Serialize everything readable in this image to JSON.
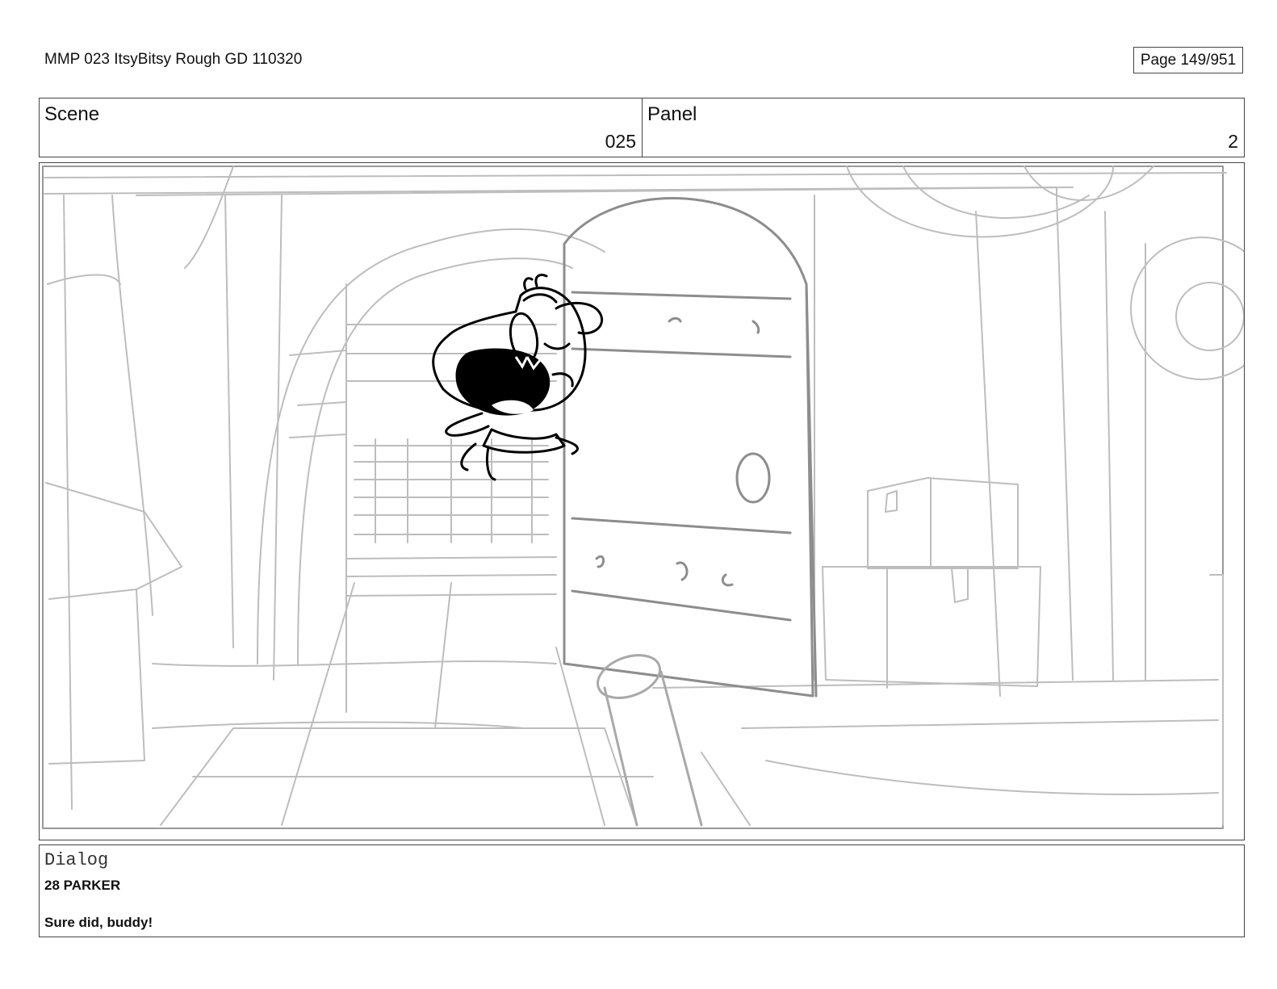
{
  "header": {
    "title": "MMP 023 ItsyBitsy Rough GD 110320",
    "page": "Page 149/951"
  },
  "meta": {
    "scene_label": "Scene",
    "scene_value": "025",
    "panel_label": "Panel",
    "panel_value": "2"
  },
  "frame": {
    "art": "rough-storyboard-sketch",
    "line_color_light": "#b5b5b5",
    "line_color_mid": "#8a8a8a",
    "ink_color": "#000000"
  },
  "dialog": {
    "label": "Dialog",
    "speaker": "28 PARKER",
    "line": "Sure did, buddy!"
  }
}
